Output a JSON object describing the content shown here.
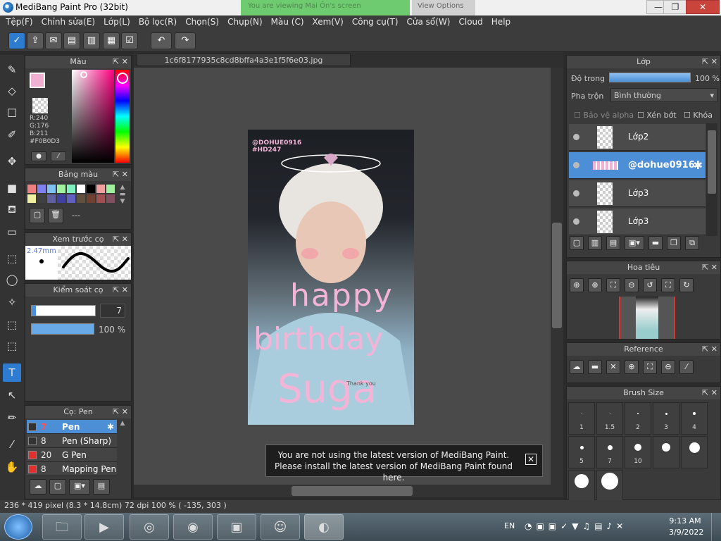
{
  "window": {
    "title": "MediBang Paint Pro (32bit)",
    "min_label": "—",
    "max_label": "❐",
    "close_label": "✕",
    "ghost_banner": "You are viewing Mai Ôn's screen",
    "ghost_button": "View Options"
  },
  "menu": [
    "Tệp(F)",
    "Chỉnh sửa(E)",
    "Lớp(L)",
    "Bộ lọc(R)",
    "Chọn(S)",
    "Chụp(N)",
    "Màu (C)",
    "Xem(V)",
    "Công cụ(T)",
    "Cửa sổ(W)",
    "Cloud",
    "Help"
  ],
  "document_tab": "1c6f8177935c8cd8bffa4a3e1f5f6e03.jpg",
  "color_panel": {
    "title": "Màu",
    "r": "R:240",
    "g": "G:176",
    "b": "B:211",
    "hex": "#F0B0D3",
    "fg_color": "#F0B0D3"
  },
  "palette_panel": {
    "title": "Bảng màu",
    "palette_name": "---",
    "swatches": [
      "#f08080",
      "#8080f0",
      "#80c0f0",
      "#a0f0a0",
      "#80f0c0",
      "#ffffff",
      "#000000",
      "#f0a0a0",
      "#a0f0a0",
      "#f0f0a0",
      "#404040",
      "#6060a0",
      "#4040a0",
      "#6060c0",
      "#605040",
      "#704030",
      "#a05050",
      "#805060"
    ]
  },
  "brush_preview": {
    "title": "Xem trước cọ",
    "size": "2.47mm"
  },
  "brush_control": {
    "title": "Kiểm soát cọ",
    "size": "7",
    "opacity": "100 %"
  },
  "brush_list": {
    "title": "Cọ: Pen",
    "items": [
      {
        "num": "7",
        "name": "Pen",
        "color": "#333333"
      },
      {
        "num": "8",
        "name": "Pen (Sharp)",
        "color": "#333333"
      },
      {
        "num": "20",
        "name": "G Pen",
        "color": "#e03030"
      },
      {
        "num": "8",
        "name": "Mapping Pen",
        "color": "#e03030"
      }
    ]
  },
  "layer_panel": {
    "title": "Lớp",
    "opacity_label": "Độ trong",
    "opacity_value": "100 %",
    "blend_label": "Pha trộn",
    "blend_value": "Bình thường",
    "alpha_label": "Bảo vệ alpha",
    "clip_label": "Xén bớt",
    "lock_label": "Khóa",
    "layers": [
      "Lớp2",
      "@dohue0916",
      "Lớp3",
      "Lớp3"
    ]
  },
  "navigator_panel": {
    "title": "Hoa tiêu"
  },
  "reference_panel": {
    "title": "Reference"
  },
  "brush_size_panel": {
    "title": "Brush Size",
    "sizes": [
      "1",
      "1.5",
      "2",
      "3",
      "4",
      "5",
      "7",
      "10",
      "",
      "",
      "",
      ""
    ]
  },
  "artwork": {
    "handle": "@DOHUE0916",
    "tag": "#HD247",
    "line1": "happy",
    "line2": "birthday",
    "line3": "Suga",
    "small": "Thank you"
  },
  "notification": {
    "line1": "You are not using the latest version of MediBang Paint.",
    "line2": "Please install the latest version of MediBang Paint found here.",
    "close": "✕"
  },
  "statusbar": {
    "text": "236 * 419 pixel   (8.3 * 14.8cm)   72 dpi   100 %   ( -135, 303 )"
  },
  "taskbar": {
    "lang": "EN",
    "time": "9:13 AM",
    "date": "3/9/2022"
  }
}
